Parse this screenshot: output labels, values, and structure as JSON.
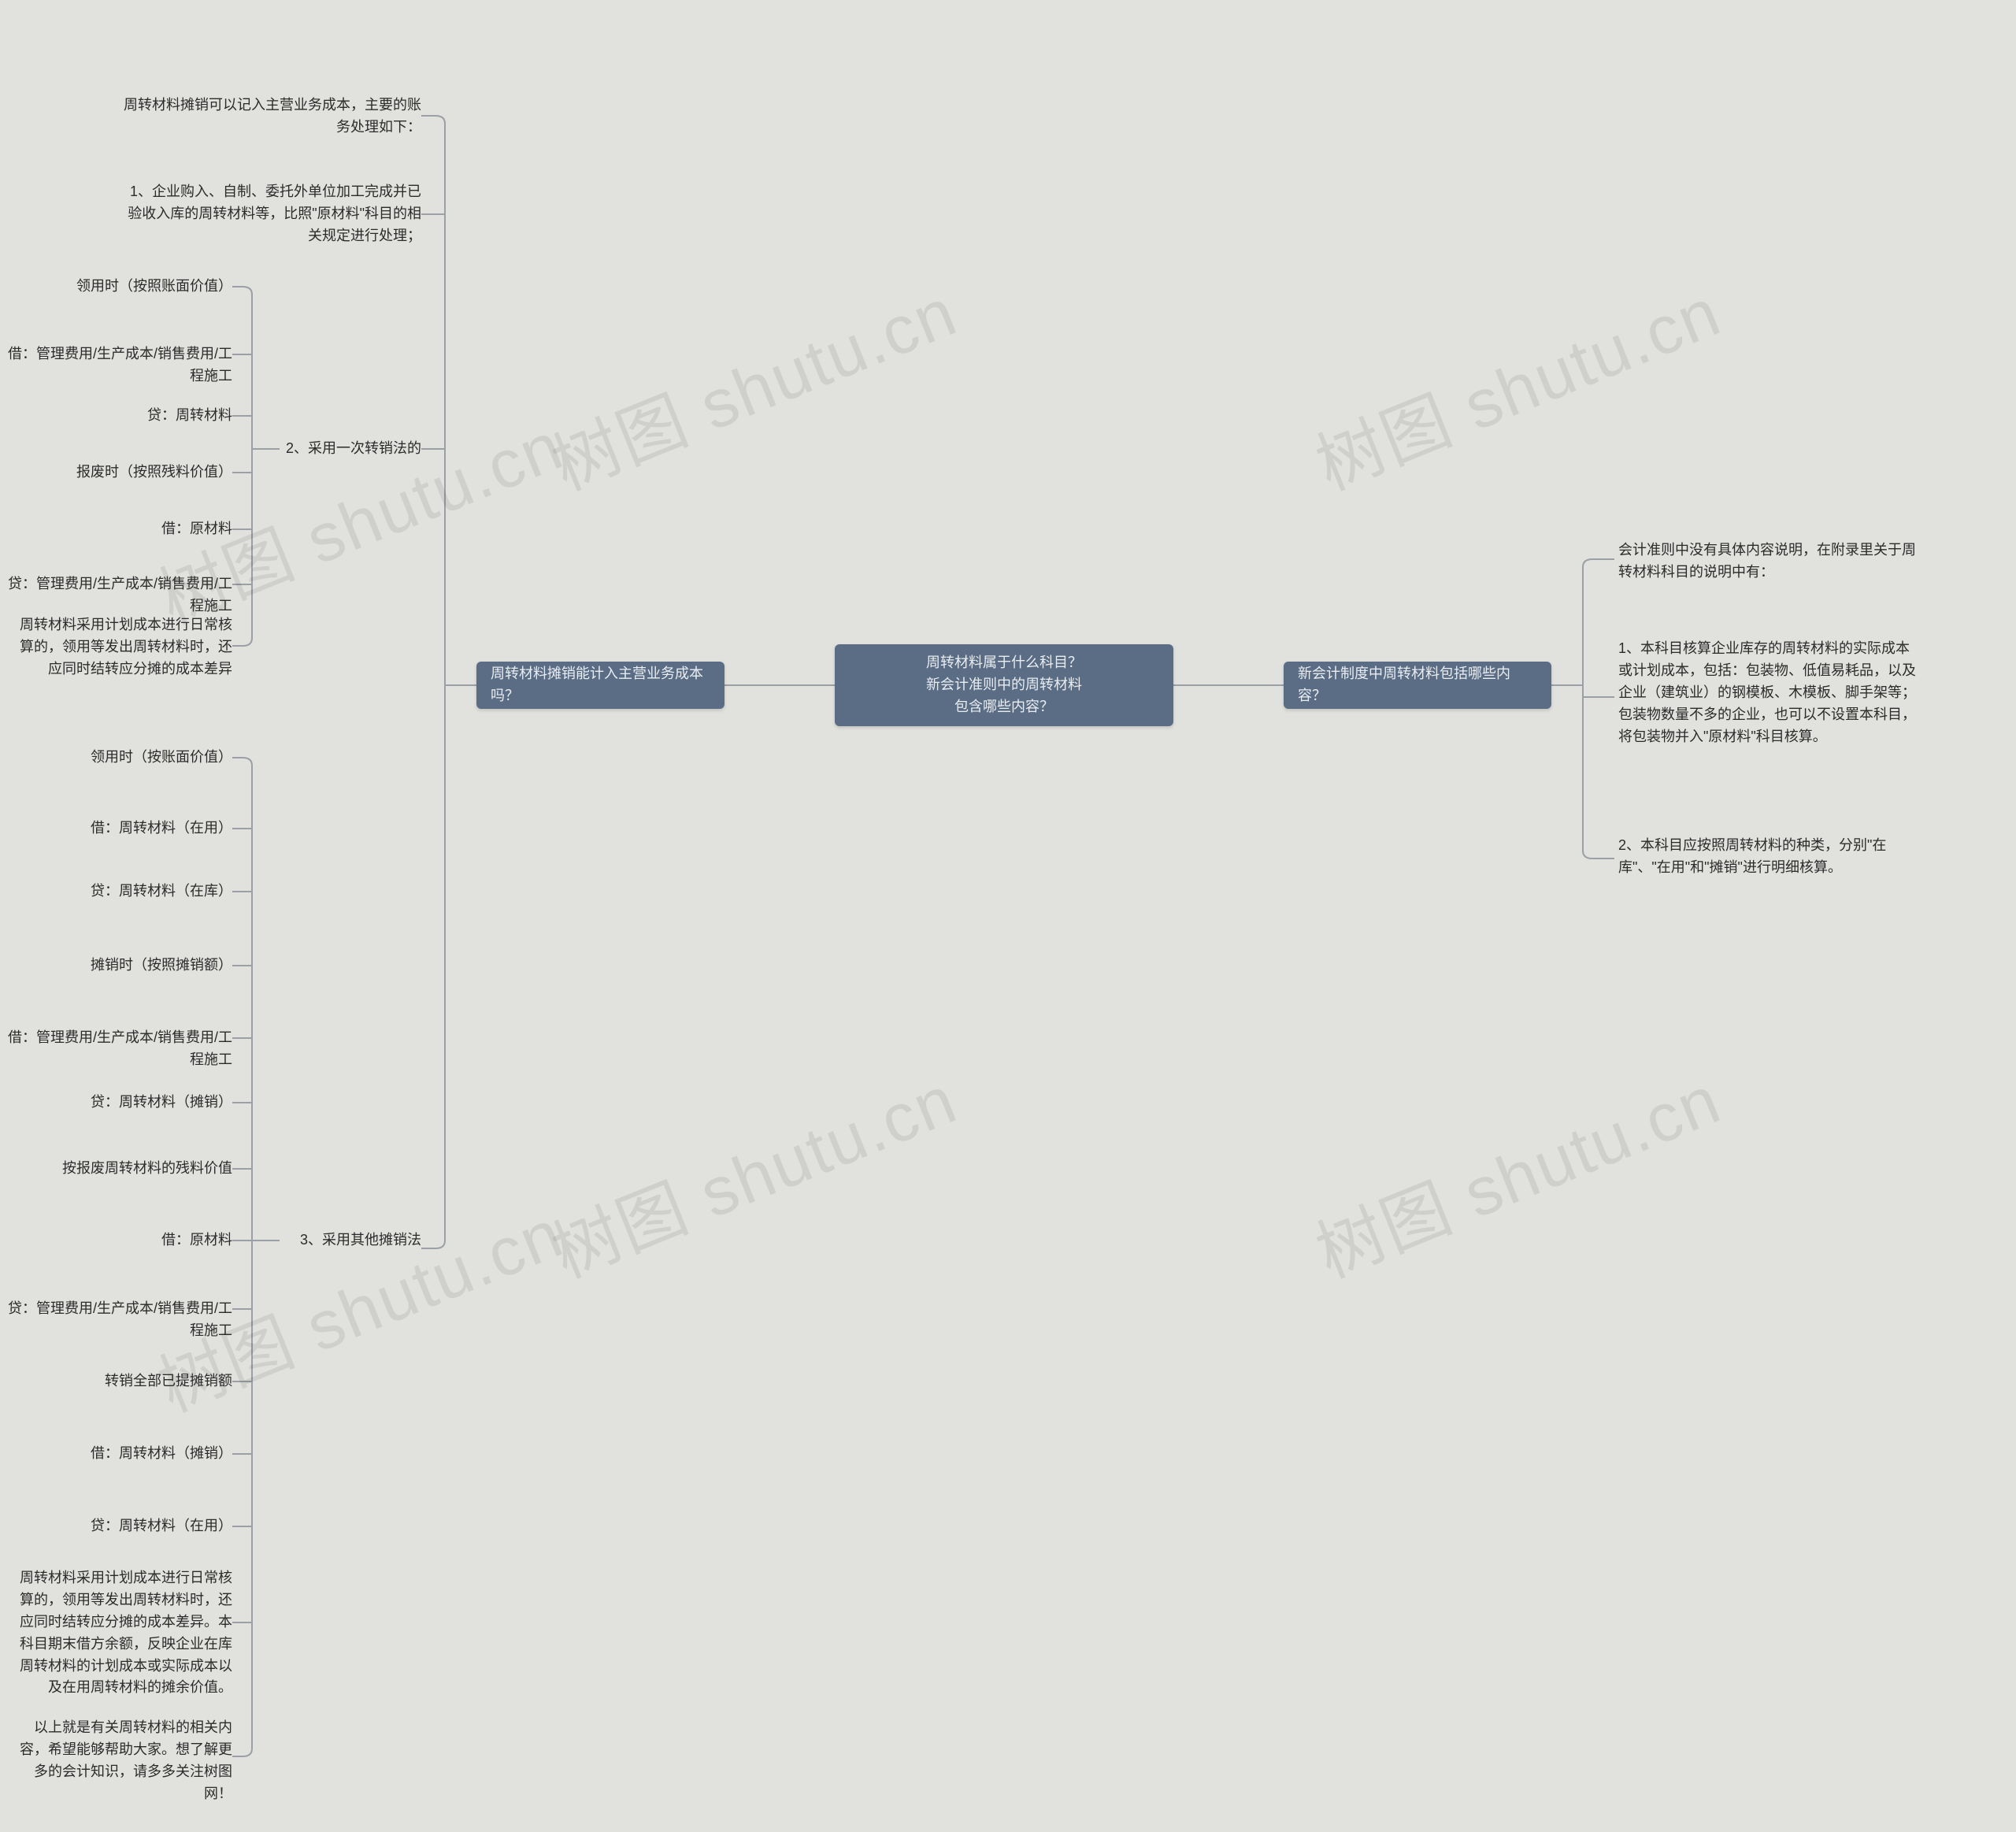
{
  "root": {
    "title_line1": "周转材料属于什么科目？",
    "title_line2": "新会计准则中的周转材料",
    "title_line3": "包含哪些内容？"
  },
  "left": {
    "branch_label": "周转材料摊销能计入主营业务成本吗？",
    "intro1": "周转材料摊销可以记入主营业务成本，主要的账务处理如下：",
    "intro2": "1、企业购入、自制、委托外单位加工完成并已验收入库的周转材料等，比照\"原材料\"科目的相关规定进行处理；",
    "method2": {
      "title": "2、采用一次转销法的",
      "items": {
        "a": "领用时（按照账面价值）",
        "b": "借：管理费用/生产成本/销售费用/工程施工",
        "c": "贷：周转材料",
        "d": "报废时（按照残料价值）",
        "e": "借：原材料",
        "f": "贷：管理费用/生产成本/销售费用/工程施工",
        "g": "周转材料采用计划成本进行日常核算的，领用等发出周转材料时，还应同时结转应分摊的成本差异"
      }
    },
    "method3": {
      "title": "3、采用其他摊销法",
      "items": {
        "a": "领用时（按账面价值）",
        "b": "借：周转材料（在用）",
        "c": "贷：周转材料（在库）",
        "d": "摊销时（按照摊销额）",
        "e": "借：管理费用/生产成本/销售费用/工程施工",
        "f": "贷：周转材料（摊销）",
        "g": "按报废周转材料的残料价值",
        "h": "借：原材料",
        "i": "贷：管理费用/生产成本/销售费用/工程施工",
        "j": "转销全部已提摊销额",
        "k": "借：周转材料（摊销）",
        "l": "贷：周转材料（在用）",
        "m": "周转材料采用计划成本进行日常核算的，领用等发出周转材料时，还应同时结转应分摊的成本差异。本科目期末借方余额，反映企业在库周转材料的计划成本或实际成本以及在用周转材料的摊余价值。",
        "n": "以上就是有关周转材料的相关内容，希望能够帮助大家。想了解更多的会计知识，请多多关注树图网！"
      }
    }
  },
  "right": {
    "branch_label": "新会计制度中周转材料包括哪些内容？",
    "items": {
      "a": "会计准则中没有具体内容说明，在附录里关于周转材料科目的说明中有：",
      "b": "1、本科目核算企业库存的周转材料的实际成本或计划成本，包括：包装物、低值易耗品，以及企业（建筑业）的钢模板、木模板、脚手架等；包装物数量不多的企业，也可以不设置本科目，将包装物并入\"原材料\"科目核算。",
      "c": "2、本科目应按照周转材料的种类，分别\"在库\"、\"在用\"和\"摊销\"进行明细核算。"
    }
  },
  "watermark_text": "树图 shutu.cn"
}
